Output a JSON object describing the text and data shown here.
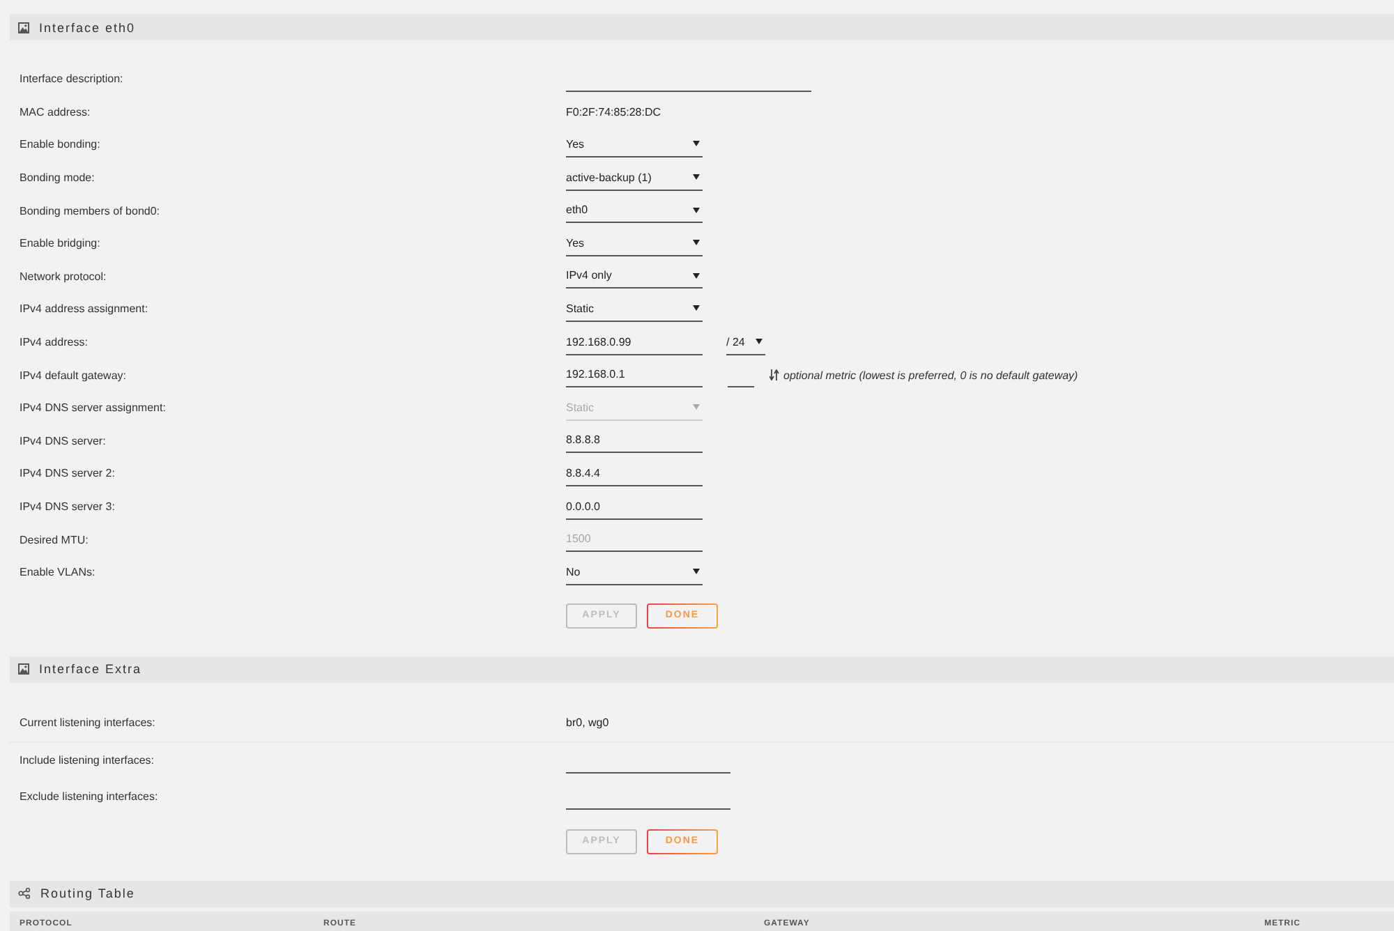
{
  "sections": [
    {
      "kind": "form",
      "title": "Interface eth0",
      "groups": [
        {
          "rows": [
            {
              "kind": "input",
              "label": "Interface description:",
              "disabled": false
            },
            {
              "kind": "text",
              "label": "MAC address:",
              "value": "F0:2F:74:85:28:DC"
            },
            {
              "kind": "select",
              "label": "Enable bonding:",
              "value": "Yes",
              "disabled": false
            },
            {
              "kind": "select",
              "label": "Bonding mode:",
              "value": "active-backup (1)",
              "disabled": false
            },
            {
              "kind": "select",
              "label": "Bonding members of bond0:",
              "value": "eth0",
              "disabled": false
            },
            {
              "kind": "select",
              "label": "Enable bridging:",
              "value": "Yes",
              "disabled": false
            },
            {
              "kind": "select",
              "label": "Network protocol:",
              "value": "IPv4 only",
              "disabled": false
            },
            {
              "kind": "select",
              "label": "IPv4 address assignment:",
              "value": "Static",
              "disabled": false
            },
            {
              "kind": "address",
              "label": "IPv4 address:",
              "value": "192.168.0.99",
              "prefix": "/ 24"
            },
            {
              "kind": "gateway",
              "label": "IPv4 default gateway:",
              "value": "192.168.0.1",
              "hint": "optional metric (lowest is preferred, 0 is no default gateway)"
            },
            {
              "kind": "select",
              "label": "IPv4 DNS server assignment:",
              "value": "Static",
              "disabled": true
            },
            {
              "kind": "input",
              "label": "IPv4 DNS server:",
              "value": "8.8.8.8",
              "disabled": false
            },
            {
              "kind": "input",
              "label": "IPv4 DNS server 2:",
              "value": "8.8.4.4",
              "disabled": false
            },
            {
              "kind": "input",
              "label": "IPv4 DNS server 3:",
              "value": "0.0.0.0",
              "disabled": false
            },
            {
              "kind": "input",
              "label": "Desired MTU:",
              "placeholder": "1500",
              "disabled": false
            },
            {
              "kind": "select",
              "label": "Enable VLANs:",
              "value": "No",
              "disabled": false
            }
          ]
        }
      ],
      "buttons": [
        {
          "label": "APPLY",
          "disabled": true
        },
        {
          "label": "DONE",
          "disabled": false
        }
      ]
    },
    {
      "kind": "form",
      "title": "Interface Extra",
      "groups": [
        {
          "rows": [
            {
              "kind": "text",
              "label": "Current listening interfaces:",
              "value": "br0, wg0"
            }
          ]
        },
        {
          "rows": [
            {
              "kind": "input",
              "label": "Include listening interfaces:",
              "disabled": false
            },
            {
              "kind": "input",
              "label": "Exclude listening interfaces:",
              "disabled": false
            }
          ]
        }
      ],
      "buttons": [
        {
          "label": "APPLY",
          "disabled": true
        },
        {
          "label": "DONE",
          "disabled": false
        }
      ]
    },
    {
      "kind": "table",
      "title": "Routing Table",
      "columns": [
        "PROTOCOL",
        "ROUTE",
        "GATEWAY",
        "METRIC"
      ]
    }
  ]
}
